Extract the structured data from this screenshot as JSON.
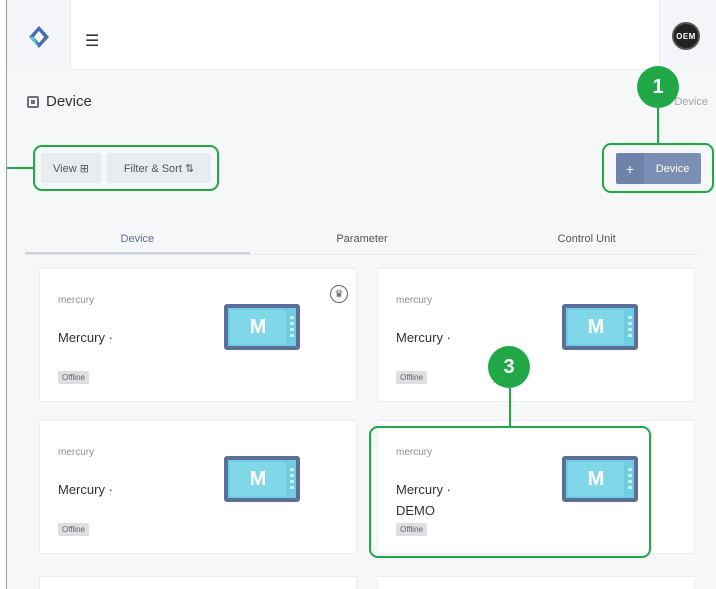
{
  "header": {
    "avatar_label": "OEM",
    "icons": [
      "logo-icon",
      "hamburger-icon"
    ]
  },
  "page": {
    "title": "Device",
    "breadcrumb": "Device"
  },
  "toolbar": {
    "view_label": "View ⊞",
    "filter_label": "Filter & Sort ⇅",
    "add_plus": "+",
    "add_label": "Device"
  },
  "tabs": [
    {
      "label": "Device",
      "active": true
    },
    {
      "label": "Parameter",
      "active": false
    },
    {
      "label": "Control Unit",
      "active": false
    }
  ],
  "cards": [
    {
      "kind": "mercury",
      "name": "Mercury ·",
      "status": "Offline",
      "image_letter": "M",
      "favorite": true
    },
    {
      "kind": "mercury",
      "name": "Mercury ·",
      "status": "Offline",
      "image_letter": "M",
      "favorite": false
    },
    {
      "kind": "mercury",
      "name": "Mercury ·",
      "status": "Offline",
      "image_letter": "M",
      "favorite": false
    },
    {
      "kind": "mercury",
      "name": "Mercury ·",
      "name2": "DEMO",
      "status": "Offline",
      "image_letter": "M",
      "favorite": false
    }
  ],
  "callouts": [
    {
      "number": "1"
    },
    {
      "number": "3"
    }
  ],
  "colors": {
    "accent": "#7b8eb3",
    "callout_green": "#1fa845",
    "device_screen": "#6fcde1"
  }
}
